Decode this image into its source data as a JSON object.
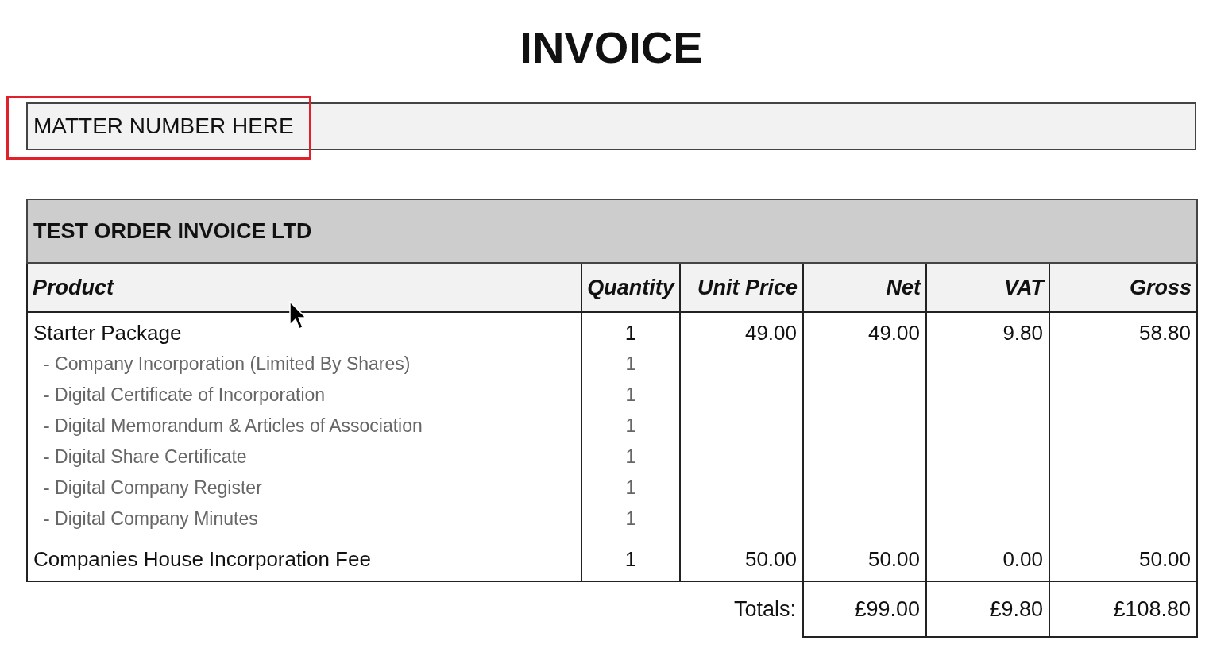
{
  "title": "INVOICE",
  "matter": {
    "text": "MATTER NUMBER HERE",
    "highlighted": true
  },
  "table": {
    "company": "TEST ORDER INVOICE LTD",
    "columns": [
      "Product",
      "Quantity",
      "Unit Price",
      "Net",
      "VAT",
      "Gross"
    ],
    "rows": [
      {
        "kind": "item",
        "product": "Starter Package",
        "quantity": "1",
        "unit_price": "49.00",
        "net": "49.00",
        "vat": "9.80",
        "gross": "58.80"
      },
      {
        "kind": "subitem",
        "product": "- Company Incorporation (Limited By Shares)",
        "quantity": "1"
      },
      {
        "kind": "subitem",
        "product": "- Digital Certificate of Incorporation",
        "quantity": "1"
      },
      {
        "kind": "subitem",
        "product": "- Digital Memorandum & Articles of Association",
        "quantity": "1"
      },
      {
        "kind": "subitem",
        "product": "- Digital Share Certificate",
        "quantity": "1"
      },
      {
        "kind": "subitem",
        "product": "- Digital Company Register",
        "quantity": "1"
      },
      {
        "kind": "subitem",
        "product": "- Digital Company Minutes",
        "quantity": "1"
      },
      {
        "kind": "item",
        "product": "Companies House Incorporation Fee",
        "quantity": "1",
        "unit_price": "50.00",
        "net": "50.00",
        "vat": "0.00",
        "gross": "50.00"
      }
    ],
    "totals": {
      "label": "Totals:",
      "net": "£99.00",
      "vat": "£9.80",
      "gross": "£108.80"
    }
  }
}
